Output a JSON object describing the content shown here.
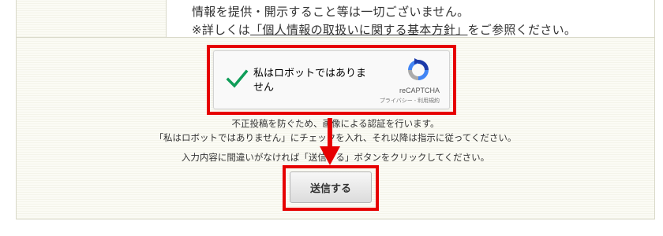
{
  "privacy": {
    "line1": "情報を提供・開示すること等は一切ございません。",
    "line2_prefix": "※詳しくは",
    "line2_link": "「個人情報の取扱いに関する基本方針」",
    "line2_suffix": "をご参照ください。"
  },
  "recaptcha": {
    "label": "私はロボットではありません",
    "brand": "reCAPTCHA",
    "terms": "プライバシー - 利用規約",
    "checked": true,
    "check_icon": "checkmark-icon",
    "logo_icon": "recaptcha-logo-icon"
  },
  "instructions": {
    "line1": "不正投稿を防ぐため、画像による認証を行います。",
    "line2": "「私はロボットではありません」にチェックを入れ、それ以降は指示に従ってください。",
    "line3": "入力内容に間違いがなければ「送信する」ボタンをクリックしてください。"
  },
  "submit": {
    "label": "送信する"
  },
  "colors": {
    "highlight": "#e60000",
    "check": "#0f9d58",
    "text": "#333333"
  }
}
